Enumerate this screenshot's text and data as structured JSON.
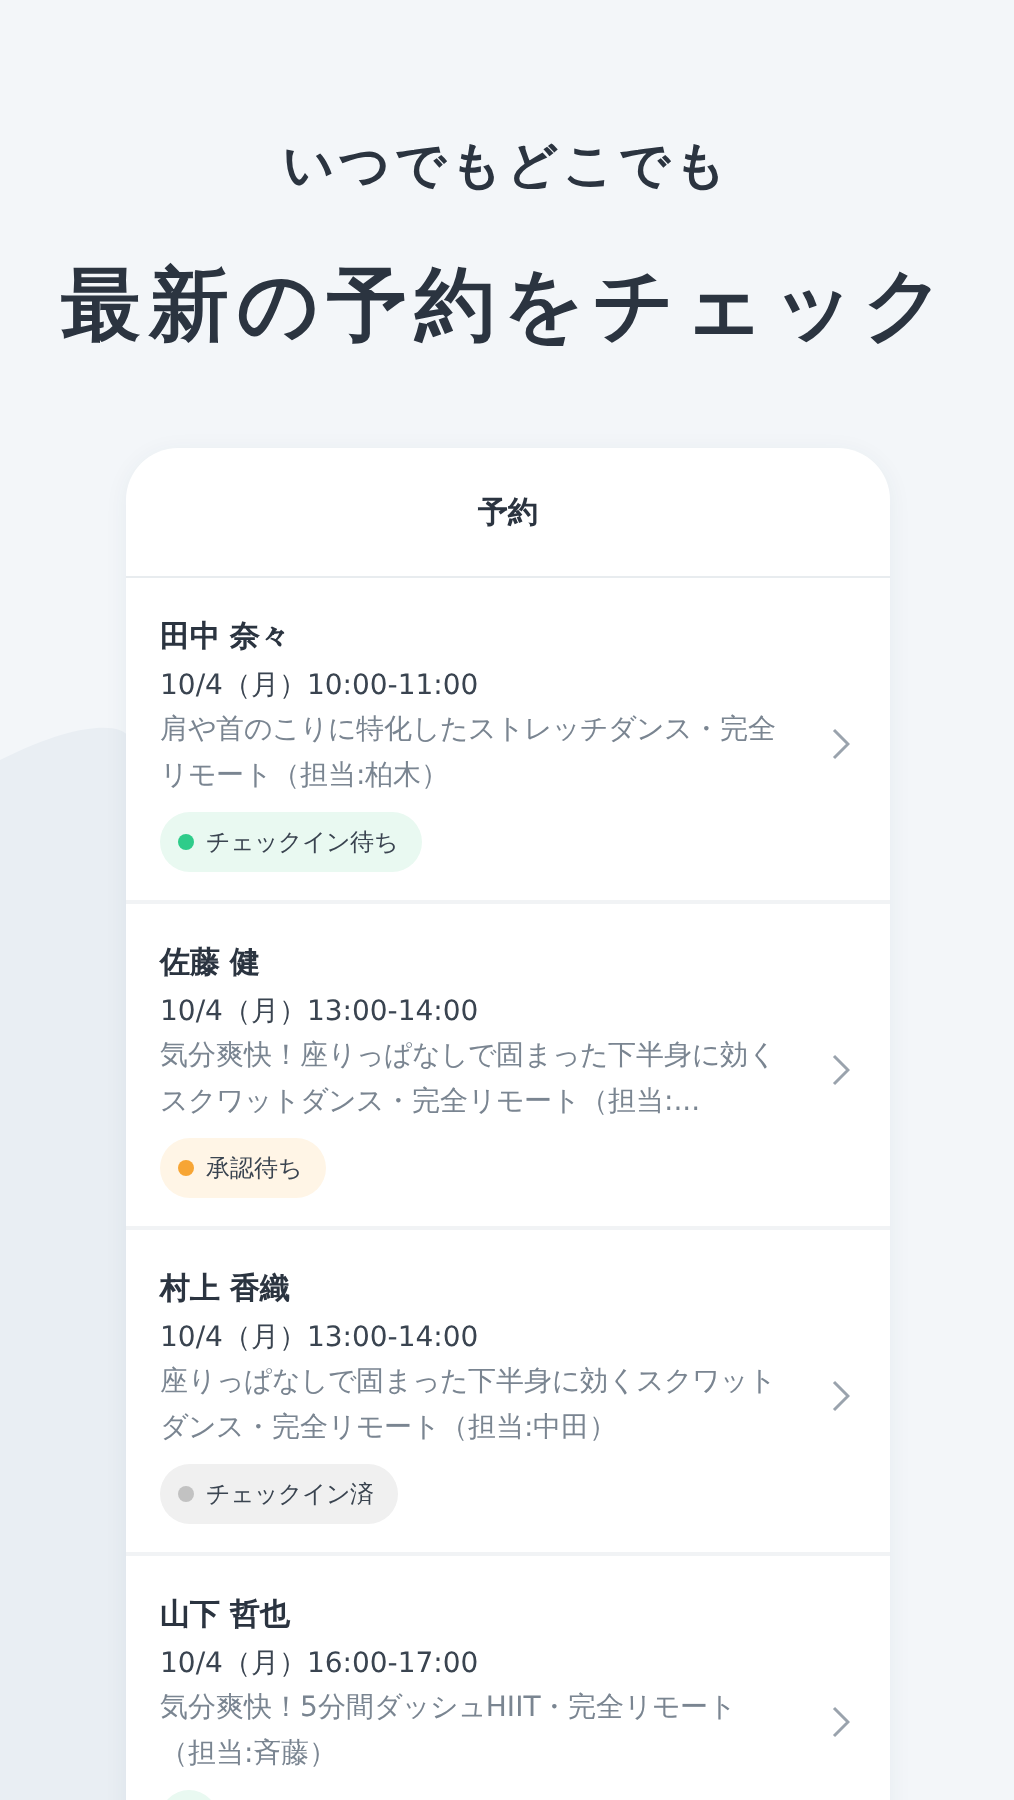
{
  "headline": {
    "subtitle": "いつでもどこでも",
    "title": "最新の予約をチェック"
  },
  "screen": {
    "title": "予約"
  },
  "reservations": [
    {
      "name": "田中 奈々",
      "datetime": "10/4（月）10:00-11:00",
      "description": "肩や首のこりに特化したストレッチダンス・完全リモート（担当:柏木）",
      "status": {
        "kind": "checkin_waiting",
        "label": "チェックイン待ち"
      }
    },
    {
      "name": "佐藤 健",
      "datetime": "10/4（月）13:00-14:00",
      "description": "気分爽快！座りっぱなしで固まった下半身に効くスクワットダンス・完全リモート（担当:...",
      "status": {
        "kind": "approval_waiting",
        "label": "承認待ち"
      }
    },
    {
      "name": "村上 香織",
      "datetime": "10/4（月）13:00-14:00",
      "description": "座りっぱなしで固まった下半身に効くスクワットダンス・完全リモート（担当:中田）",
      "status": {
        "kind": "checked_in",
        "label": "チェックイン済"
      }
    },
    {
      "name": "山下 哲也",
      "datetime": "10/4（月）16:00-17:00",
      "description": "気分爽快！5分間ダッシュHIIT・完全リモート（担当:斉藤）",
      "status": {
        "kind": "checkin_waiting"
      }
    }
  ]
}
